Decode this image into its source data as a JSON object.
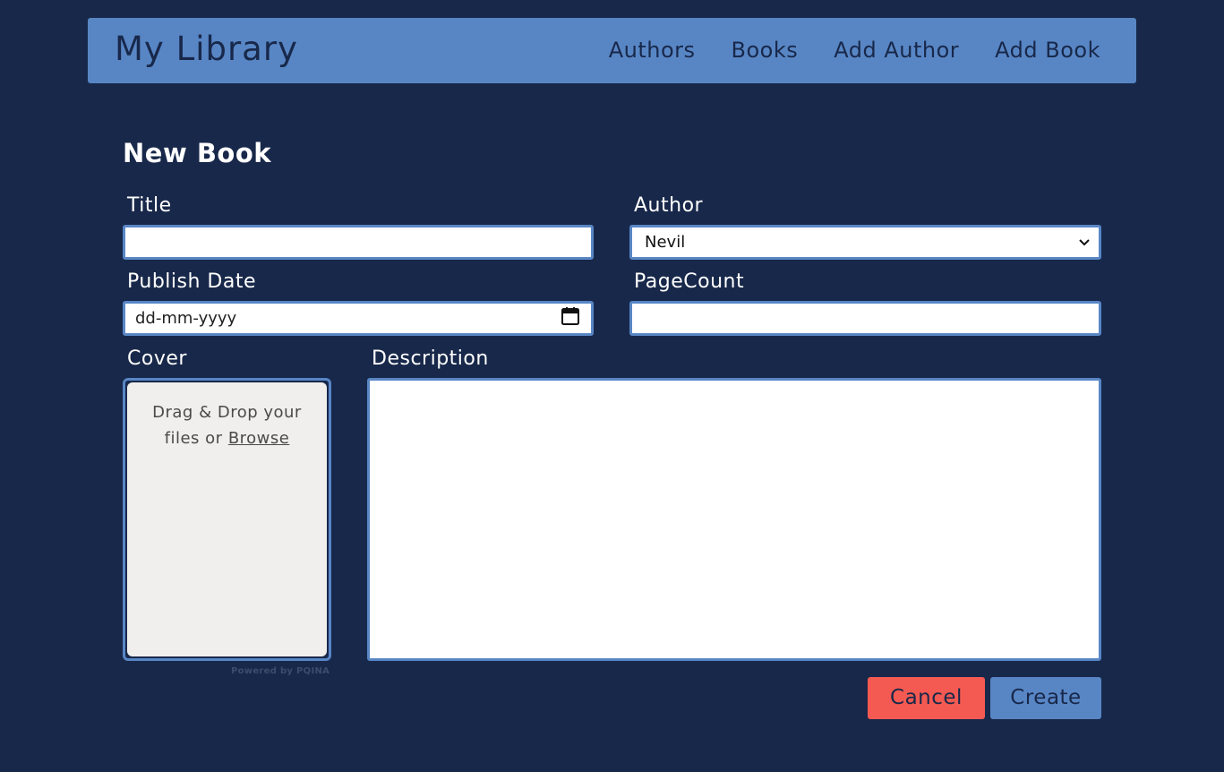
{
  "header": {
    "brand": "My Library",
    "nav": [
      "Authors",
      "Books",
      "Add Author",
      "Add Book"
    ]
  },
  "page": {
    "title": "New Book"
  },
  "form": {
    "title_label": "Title",
    "title_value": "",
    "author_label": "Author",
    "author_selected": "Nevil",
    "publish_date_label": "Publish Date",
    "publish_date_placeholder": "dd-mm-yyyy",
    "page_count_label": "PageCount",
    "page_count_value": "",
    "cover_label": "Cover",
    "cover_drop_text_1": "Drag & Drop your",
    "cover_drop_text_2": "files or",
    "cover_browse": "Browse",
    "cover_powered_by": "Powered by PQINA",
    "description_label": "Description",
    "description_value": ""
  },
  "actions": {
    "cancel": "Cancel",
    "create": "Create"
  },
  "colors": {
    "background": "#18284a",
    "accent": "#5886c5",
    "cancel": "#f55a52"
  },
  "icons": {
    "date": "calendar-icon",
    "select": "chevron-down-icon"
  }
}
